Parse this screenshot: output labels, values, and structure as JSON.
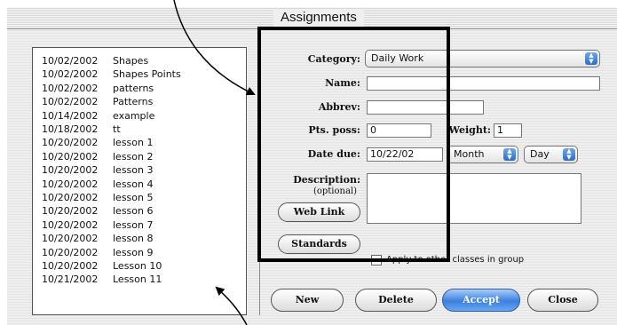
{
  "window": {
    "title": "Assignments"
  },
  "assignments": [
    {
      "date": "10/02/2002",
      "name": "Shapes"
    },
    {
      "date": "10/02/2002",
      "name": "Shapes Points"
    },
    {
      "date": "10/02/2002",
      "name": "patterns"
    },
    {
      "date": "10/02/2002",
      "name": "Patterns"
    },
    {
      "date": "10/14/2002",
      "name": "example"
    },
    {
      "date": "10/18/2002",
      "name": "tt"
    },
    {
      "date": "10/20/2002",
      "name": "lesson 1"
    },
    {
      "date": "10/20/2002",
      "name": "lesson 2"
    },
    {
      "date": "10/20/2002",
      "name": "lesson 3"
    },
    {
      "date": "10/20/2002",
      "name": "lesson 4"
    },
    {
      "date": "10/20/2002",
      "name": "lesson 5"
    },
    {
      "date": "10/20/2002",
      "name": "lesson 6"
    },
    {
      "date": "10/20/2002",
      "name": "lesson 7"
    },
    {
      "date": "10/20/2002",
      "name": "lesson 8"
    },
    {
      "date": "10/20/2002",
      "name": "lesson 9"
    },
    {
      "date": "10/20/2002",
      "name": "Lesson 10"
    },
    {
      "date": "10/21/2002",
      "name": "Lesson 11"
    }
  ],
  "form": {
    "category_label": "Category:",
    "category_value": "Daily Work",
    "name_label": "Name:",
    "name_value": "",
    "abbrev_label": "Abbrev:",
    "abbrev_value": "",
    "pts_label": "Pts. poss:",
    "pts_value": "0",
    "weight_label": "Weight:",
    "weight_value": "1",
    "date_label": "Date due:",
    "date_value": "10/22/02",
    "month_value": "Month",
    "day_value": "Day",
    "description_label": "Description:",
    "description_sub": "(optional)",
    "description_value": "",
    "weblink_label": "Web Link",
    "standards_label": "Standards",
    "apply_label": "Apply to other classes in group",
    "apply_checked": false
  },
  "buttons": {
    "new": "New",
    "delete": "Delete",
    "accept": "Accept",
    "close": "Close"
  },
  "colors": {
    "accent": "#3a7fe0",
    "highlight_box": "#000000"
  }
}
